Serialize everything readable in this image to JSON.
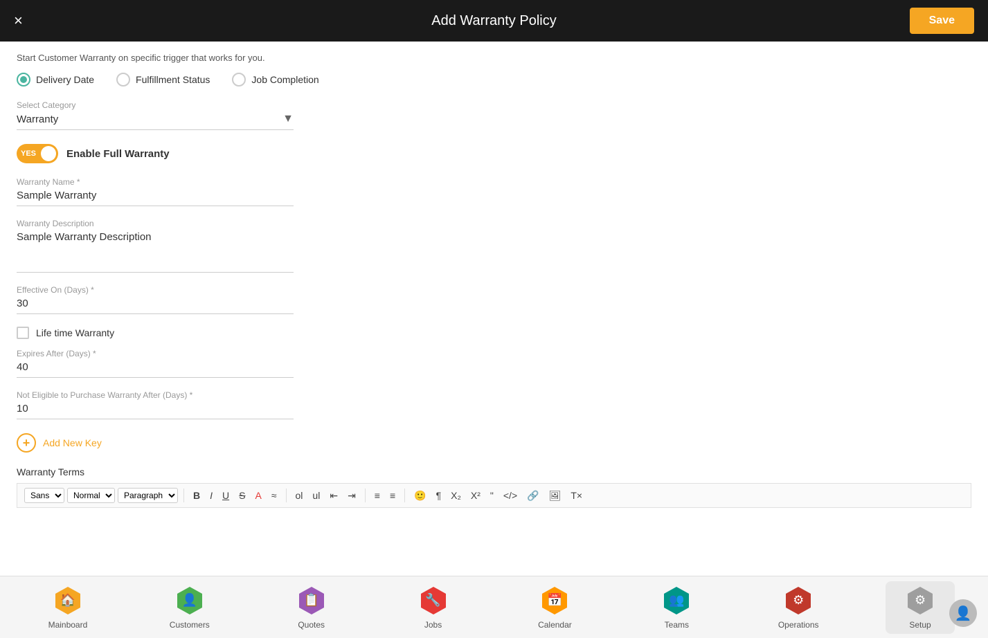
{
  "header": {
    "title": "Add Warranty Policy",
    "close_label": "×",
    "save_label": "Save"
  },
  "form": {
    "subtitle": "Start Customer Warranty on specific trigger that works for you.",
    "triggers": [
      {
        "id": "delivery_date",
        "label": "Delivery Date",
        "selected": true
      },
      {
        "id": "fulfillment_status",
        "label": "Fulfillment Status",
        "selected": false
      },
      {
        "id": "job_completion",
        "label": "Job Completion",
        "selected": false
      }
    ],
    "category": {
      "label": "Select Category",
      "value": "Warranty"
    },
    "toggle": {
      "enabled": true,
      "yes_label": "YES",
      "field_label": "Enable Full Warranty"
    },
    "warranty_name": {
      "label": "Warranty Name *",
      "value": "Sample Warranty"
    },
    "warranty_description": {
      "label": "Warranty Description",
      "value": "Sample Warranty Description"
    },
    "effective_on": {
      "label": "Effective On (Days) *",
      "value": "30"
    },
    "lifetime_warranty": {
      "label": "Life time Warranty",
      "checked": false
    },
    "expires_after": {
      "label": "Expires After (Days) *",
      "value": "40"
    },
    "not_eligible": {
      "label": "Not Eligible to Purchase Warranty After (Days) *",
      "value": "10"
    },
    "add_new_key_label": "Add New Key",
    "warranty_terms_label": "Warranty Terms"
  },
  "toolbar": {
    "font_family": "Sans",
    "font_weight": "Normal",
    "paragraph": "Paragraph",
    "buttons": [
      "B",
      "I",
      "U",
      "S",
      "A",
      "≈",
      "ol",
      "ul",
      "indent_dec",
      "indent_inc",
      "align_left",
      "align_right",
      "emoji",
      "pilcrow",
      "sub",
      "sup",
      "quote",
      "code",
      "link",
      "image",
      "clear"
    ]
  },
  "bottom_nav": {
    "items": [
      {
        "id": "mainboard",
        "label": "Mainboard",
        "color": "yellow",
        "icon": "🏠"
      },
      {
        "id": "customers",
        "label": "Customers",
        "color": "green",
        "icon": "👤"
      },
      {
        "id": "quotes",
        "label": "Quotes",
        "color": "purple",
        "icon": "📋"
      },
      {
        "id": "jobs",
        "label": "Jobs",
        "color": "red",
        "icon": "🔧"
      },
      {
        "id": "calendar",
        "label": "Calendar",
        "color": "orange",
        "icon": "📅"
      },
      {
        "id": "teams",
        "label": "Teams",
        "color": "teal",
        "icon": "👥"
      },
      {
        "id": "operations",
        "label": "Operations",
        "color": "crimson",
        "icon": "⚙"
      },
      {
        "id": "setup",
        "label": "Setup",
        "color": "gray",
        "icon": "⚙"
      }
    ]
  }
}
